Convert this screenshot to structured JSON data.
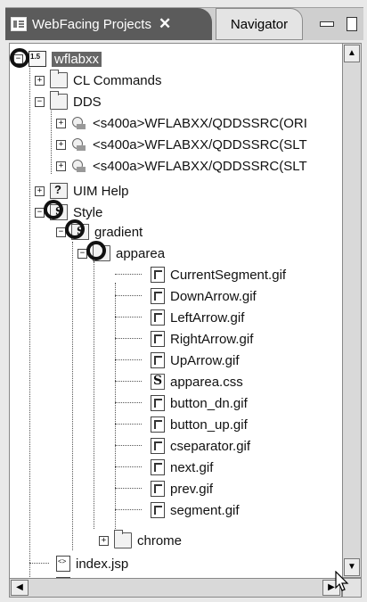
{
  "tabs": [
    {
      "label": "WebFacing Projects"
    },
    {
      "label": "Navigator"
    }
  ],
  "tree": {
    "items": [
      {
        "label": "wflabxx"
      },
      {
        "label": "CL Commands"
      },
      {
        "label": "DDS"
      },
      {
        "label": "<s400a>WFLABXX/QDDSSRC(ORI"
      },
      {
        "label": "<s400a>WFLABXX/QDDSSRC(SLT"
      },
      {
        "label": "<s400a>WFLABXX/QDDSSRC(SLT"
      },
      {
        "label": "UIM Help"
      },
      {
        "label": "Style"
      },
      {
        "label": "gradient"
      },
      {
        "label": "apparea"
      },
      {
        "label": "CurrentSegment.gif"
      },
      {
        "label": "DownArrow.gif"
      },
      {
        "label": "LeftArrow.gif"
      },
      {
        "label": "RightArrow.gif"
      },
      {
        "label": "UpArrow.gif"
      },
      {
        "label": "apparea.css"
      },
      {
        "label": "button_dn.gif"
      },
      {
        "label": "button_up.gif"
      },
      {
        "label": "cseparator.gif"
      },
      {
        "label": "next.gif"
      },
      {
        "label": "prev.gif"
      },
      {
        "label": "segment.gif"
      },
      {
        "label": "chrome"
      },
      {
        "label": "index.jsp"
      }
    ]
  }
}
